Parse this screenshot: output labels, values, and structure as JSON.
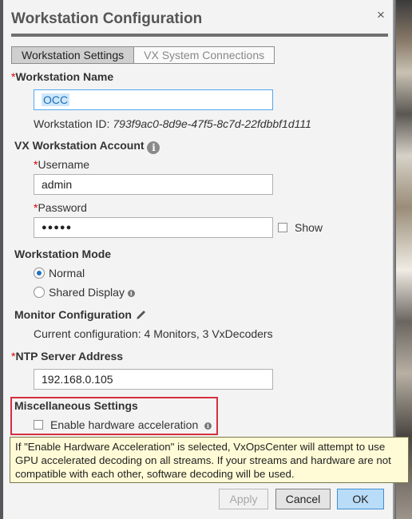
{
  "dialog": {
    "title": "Workstation Configuration",
    "close_glyph": "×"
  },
  "tabs": [
    {
      "label": "Workstation Settings",
      "active": true
    },
    {
      "label": "VX System Connections",
      "active": false
    }
  ],
  "workstation_name": {
    "required_mark": "*",
    "label": "Workstation Name",
    "value": "OCC",
    "id_label": "Workstation ID:",
    "id_value": "793f9ac0-8d9e-47f5-8c7d-22fdbbf1d111"
  },
  "account": {
    "label": "VX Workstation Account",
    "info_icon": "info-icon",
    "username_label": "Username",
    "username_value": "admin",
    "password_label": "Password",
    "password_value": "●●●●●",
    "show_label": "Show",
    "show_checked": false
  },
  "mode": {
    "label": "Workstation Mode",
    "options": [
      {
        "label": "Normal",
        "selected": true
      },
      {
        "label": "Shared Display",
        "selected": false
      }
    ]
  },
  "monitor": {
    "label": "Monitor Configuration",
    "edit_icon": "pencil-icon",
    "current": "Current configuration: 4 Monitors, 3 VxDecoders"
  },
  "ntp": {
    "label": "NTP Server Address",
    "value": "192.168.0.105"
  },
  "misc": {
    "label": "Miscellaneous Settings",
    "hw_accel_label": "Enable hardware acceleration",
    "hw_accel_checked": false
  },
  "tooltip": {
    "text": "If \"Enable Hardware Acceleration\" is selected, VxOpsCenter will attempt to use GPU accelerated decoding on all streams.  If your streams and hardware are not compatible with each other, software decoding will be used."
  },
  "buttons": {
    "apply": "Apply",
    "cancel": "Cancel",
    "ok": "OK"
  },
  "colors": {
    "required": "#dd0000",
    "highlight_border": "#d6303d",
    "tooltip_bg": "#fffbd6",
    "primary_button": "#b9dcf8"
  }
}
